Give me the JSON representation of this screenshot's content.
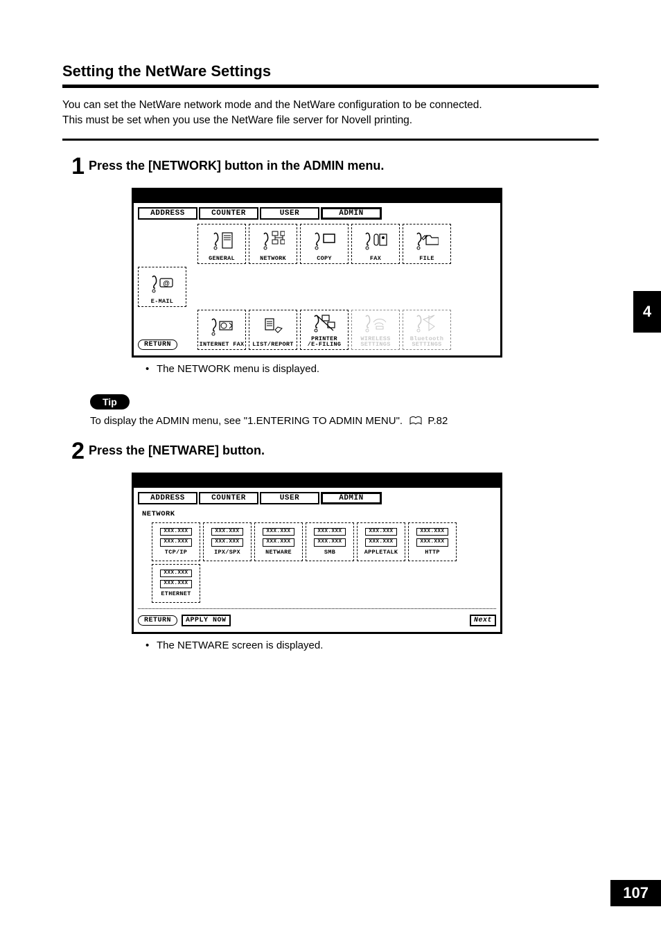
{
  "section_title": "Setting the NetWare Settings",
  "intro_line1": "You can set the NetWare network mode and the NetWare configuration to be connected.",
  "intro_line2": "This must be set when you use the NetWare file server for Novell printing.",
  "step1": {
    "num": "1",
    "title": "Press the [NETWORK] button in the ADMIN menu.",
    "note": "The NETWORK menu is displayed."
  },
  "step2": {
    "num": "2",
    "title": "Press the [NETWARE] button.",
    "note": "The NETWARE screen is displayed."
  },
  "tip": {
    "label": "Tip",
    "text_before": "To display the ADMIN menu, see \"1.ENTERING TO ADMIN MENU\".",
    "pageref": "P.82"
  },
  "tabs": {
    "address": "ADDRESS",
    "counter": "COUNTER",
    "user": "USER",
    "admin": "ADMIN"
  },
  "screen1": {
    "return": "RETURN",
    "buttons": {
      "general": "GENERAL",
      "network": "NETWORK",
      "copy": "COPY",
      "fax": "FAX",
      "file": "FILE",
      "email": "E-MAIL",
      "internet_fax": "INTERNET FAX",
      "list_report": "LIST/REPORT",
      "printer_efiling": "PRINTER\n/E-FILING",
      "wireless": "WIRELESS\nSETTINGS",
      "bluetooth": "Bluetooth\nSETTINGS"
    }
  },
  "screen2": {
    "breadcrumb": "NETWORK",
    "return": "RETURN",
    "apply": "APPLY NOW",
    "next": "Next",
    "placeholder": "XXX.XXX",
    "buttons": {
      "tcpip": "TCP/IP",
      "ipxspx": "IPX/SPX",
      "netware": "NETWARE",
      "smb": "SMB",
      "appletalk": "APPLETALK",
      "http": "HTTP",
      "ethernet": "ETHERNET"
    }
  },
  "chapter": "4",
  "page_number": "107"
}
